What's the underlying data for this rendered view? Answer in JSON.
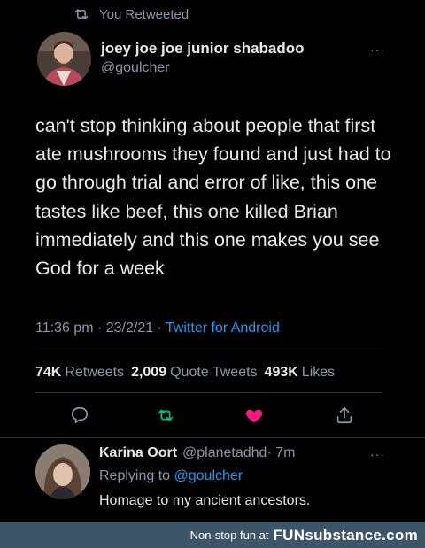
{
  "retweet": {
    "label": "You Retweeted",
    "icon": "retweet-icon"
  },
  "author": {
    "name": "joey joe joe junior shabadoo",
    "handle": "@goulcher"
  },
  "more_label": "···",
  "tweet_text": "can't stop thinking about people that first ate mushrooms they found and just had to go through trial and error of like, this one tastes like beef, this one killed Brian immediately and this one makes you see God for a week",
  "meta": {
    "time": "11:36 pm · 23/2/21 ·",
    "client": "Twitter for Android"
  },
  "stats": {
    "retweets_count": "74K",
    "retweets_label": "Retweets",
    "quotes_count": "2,009",
    "quotes_label": "Quote Tweets",
    "likes_count": "493K",
    "likes_label": "Likes"
  },
  "actions": [
    {
      "icon": "reply-icon"
    },
    {
      "icon": "retweet-icon",
      "active_color": "#00ba7c"
    },
    {
      "icon": "heart-icon",
      "active_color": "#f91880"
    },
    {
      "icon": "share-icon"
    }
  ],
  "reply": {
    "name": "Karina Oort",
    "handle": "@planetadhd",
    "time": "· 7m",
    "replying_prefix": "Replying to",
    "replying_to": "@goulcher",
    "text": "Homage to my ancient ancestors."
  },
  "footer": {
    "tagline": "Non-stop fun at",
    "brand": "FUNsubstance.com"
  },
  "colors": {
    "background": "#000000",
    "link": "#1d9bf0",
    "muted": "#8b98a5",
    "footer_bar": "#3d5568"
  }
}
